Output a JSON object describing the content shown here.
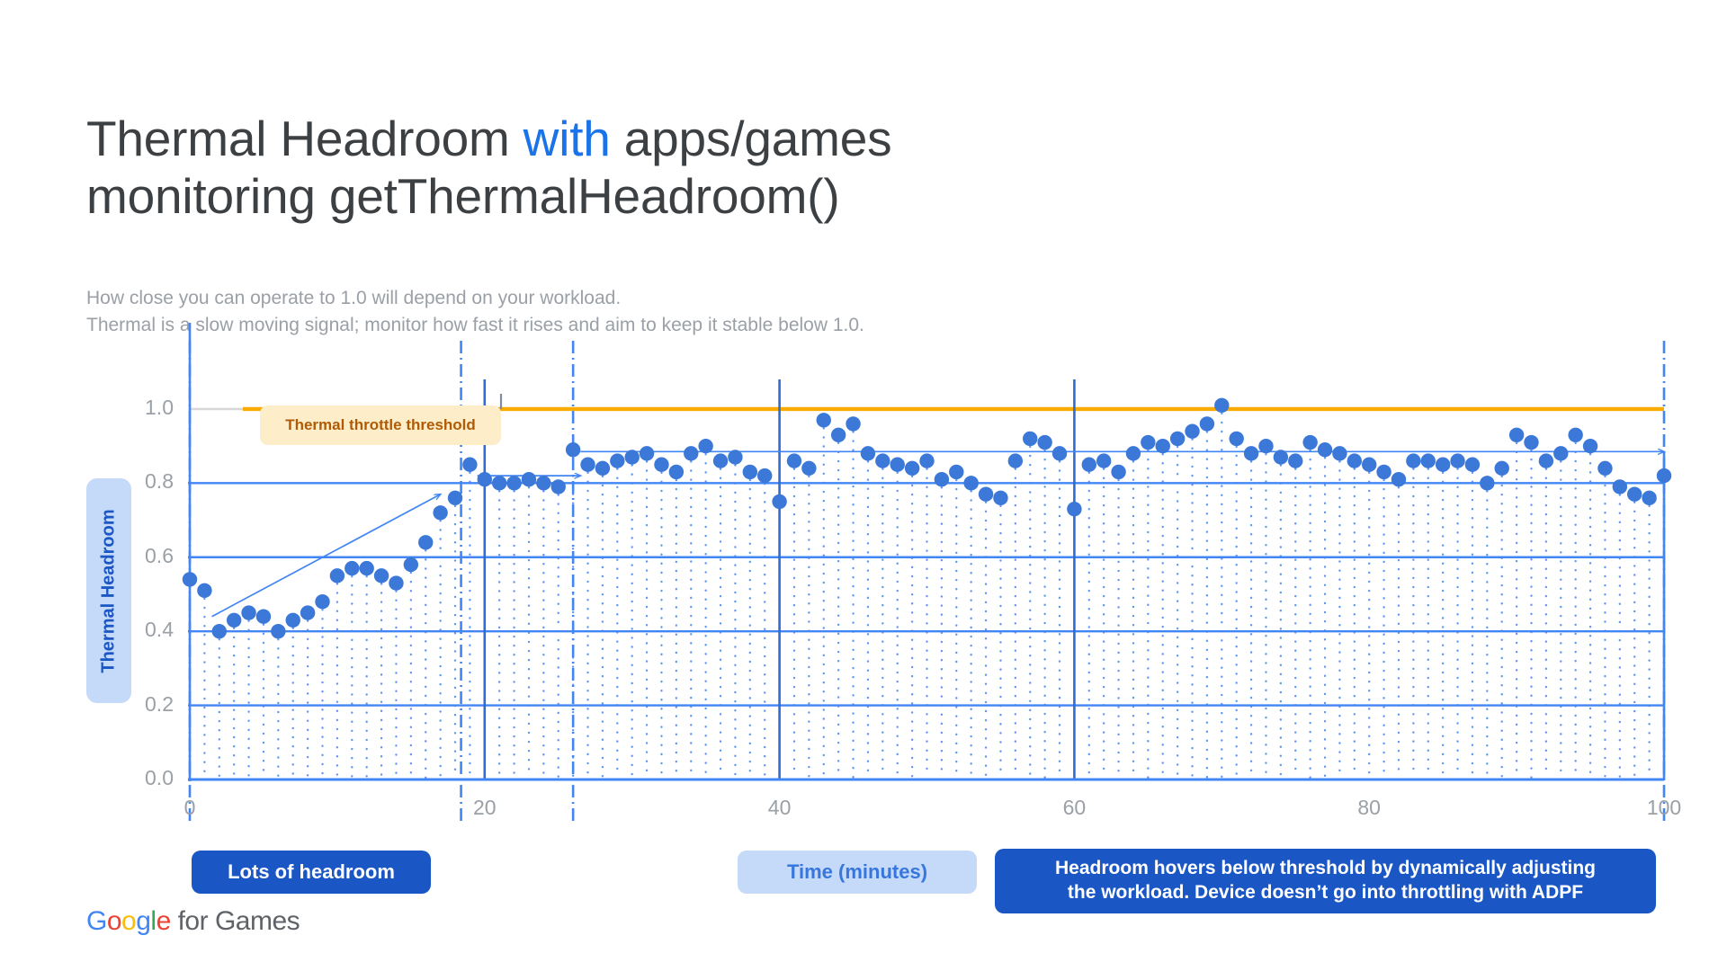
{
  "title": {
    "part1": "Thermal Headroom ",
    "accent": "with",
    "part2": " apps/games",
    "line2": "monitoring getThermalHeadroom()"
  },
  "subtitle": {
    "line1": "How close you can operate to 1.0 will depend on your workload.",
    "line2": "Thermal is a slow moving signal; monitor how fast it rises and aim to keep it stable below 1.0."
  },
  "annotations": {
    "threshold_label": "Thermal throttle threshold",
    "lots_of_headroom": "Lots of headroom",
    "time_axis_label": "Time (minutes)",
    "callout_line1": "Headroom hovers below threshold by dynamically adjusting",
    "callout_line2": "the workload. Device doesn’t go into throttling with ADPF"
  },
  "logo": {
    "g1": "G",
    "o1": "o",
    "o2": "o",
    "g2": "g",
    "l1": "l",
    "e1": "e",
    "suffix": " for Games"
  },
  "colors": {
    "accent_blue": "#1a73e8",
    "marker_blue": "#3b78d8",
    "grid_blue": "#4285f4",
    "threshold_orange": "#f9ab00",
    "pill_blue": "#1a56c4",
    "pill_light_blue": "#c5d9f8",
    "pill_yellow": "#fdeec9",
    "text_gray": "#9aa0a6",
    "title_gray": "#3c4043"
  },
  "chart_data": {
    "type": "scatter",
    "title": "Thermal Headroom with apps/games monitoring getThermalHeadroom()",
    "xlabel": "Time (minutes)",
    "ylabel": "Thermal Headroom",
    "xlim": [
      0,
      100
    ],
    "ylim": [
      0.0,
      1.16
    ],
    "xticks": [
      0,
      20,
      40,
      60,
      80,
      100
    ],
    "yticks": [
      "0.0",
      "0.2",
      "0.4",
      "0.6",
      "0.8",
      "1.0"
    ],
    "grid": true,
    "legend": false,
    "threshold": {
      "value": 1.0,
      "label": "Thermal throttle threshold",
      "color": "#f9ab00"
    },
    "vertical_markers": [
      0,
      18.4,
      26,
      100
    ],
    "x": [
      0,
      1,
      2,
      3,
      4,
      5,
      6,
      7,
      8,
      9,
      10,
      11,
      12,
      13,
      14,
      15,
      16,
      17,
      18,
      19,
      20,
      21,
      22,
      23,
      24,
      25,
      26,
      27,
      28,
      29,
      30,
      31,
      32,
      33,
      34,
      35,
      36,
      37,
      38,
      39,
      40,
      41,
      42,
      43,
      44,
      45,
      46,
      47,
      48,
      49,
      50,
      51,
      52,
      53,
      54,
      55,
      56,
      57,
      58,
      59,
      60,
      61,
      62,
      63,
      64,
      65,
      66,
      67,
      68,
      69,
      70,
      71,
      72,
      73,
      74,
      75,
      76,
      77,
      78,
      79,
      80,
      81,
      82,
      83,
      84,
      85,
      86,
      87,
      88,
      89,
      90,
      91,
      92,
      93,
      94,
      95,
      96,
      97,
      98,
      99,
      100
    ],
    "y": [
      0.54,
      0.51,
      0.4,
      0.43,
      0.45,
      0.44,
      0.4,
      0.43,
      0.45,
      0.48,
      0.55,
      0.57,
      0.57,
      0.55,
      0.53,
      0.58,
      0.64,
      0.72,
      0.76,
      0.85,
      0.81,
      0.8,
      0.8,
      0.81,
      0.8,
      0.79,
      0.89,
      0.85,
      0.84,
      0.86,
      0.87,
      0.88,
      0.85,
      0.83,
      0.88,
      0.9,
      0.86,
      0.87,
      0.83,
      0.82,
      0.75,
      0.86,
      0.84,
      0.97,
      0.93,
      0.96,
      0.88,
      0.86,
      0.85,
      0.84,
      0.86,
      0.81,
      0.83,
      0.8,
      0.77,
      0.76,
      0.86,
      0.92,
      0.91,
      0.88,
      0.73,
      0.85,
      0.86,
      0.83,
      0.88,
      0.91,
      0.9,
      0.92,
      0.94,
      0.96,
      1.01,
      0.92,
      0.88,
      0.9,
      0.87,
      0.86,
      0.91,
      0.89,
      0.88,
      0.86,
      0.85,
      0.83,
      0.81,
      0.86,
      0.86,
      0.85,
      0.86,
      0.85,
      0.8,
      0.84,
      0.93,
      0.91,
      0.86,
      0.88,
      0.93,
      0.9,
      0.84,
      0.79,
      0.77,
      0.76,
      0.82
    ],
    "arrows": [
      {
        "note": "rising headroom arrow",
        "x1": 1.5,
        "y1": 0.44,
        "x2": 17.0,
        "y2": 0.77
      },
      {
        "note": "stabilised plateau arrow near 0.82",
        "x1": 19.5,
        "y1": 0.82,
        "x2": 26.5,
        "y2": 0.82
      },
      {
        "note": "long plateau arrow near 0.88",
        "x1": 26.5,
        "y1": 0.885,
        "x2": 100,
        "y2": 0.885
      }
    ]
  }
}
